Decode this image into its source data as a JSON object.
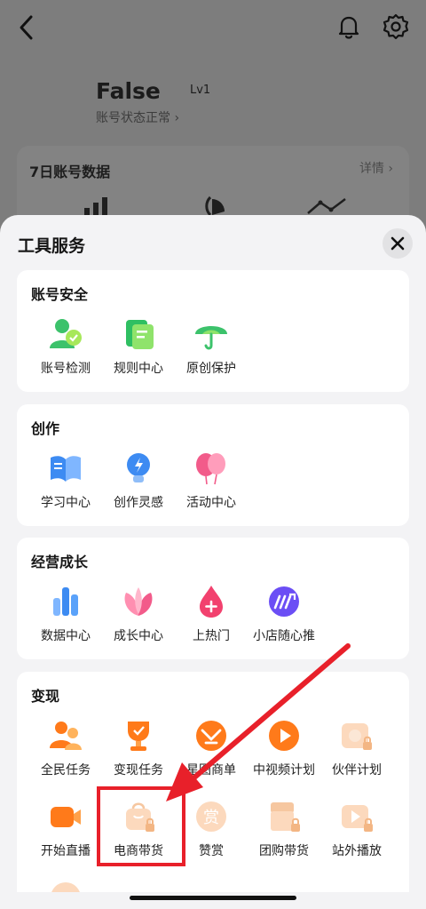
{
  "background": {
    "profile_name": "False",
    "level": "Lv1",
    "account_status": "账号状态正常 ›",
    "data_card": {
      "title": "7日账号数据",
      "more": "详情 ›"
    }
  },
  "sheet": {
    "title": "工具服务",
    "sections": [
      {
        "title": "账号安全",
        "items": [
          {
            "label": "账号检测",
            "icon": "account-check-icon"
          },
          {
            "label": "规则中心",
            "icon": "rules-icon"
          },
          {
            "label": "原创保护",
            "icon": "umbrella-icon"
          }
        ]
      },
      {
        "title": "创作",
        "items": [
          {
            "label": "学习中心",
            "icon": "book-icon"
          },
          {
            "label": "创作灵感",
            "icon": "lightbulb-icon"
          },
          {
            "label": "活动中心",
            "icon": "balloon-icon"
          }
        ]
      },
      {
        "title": "经营成长",
        "items": [
          {
            "label": "数据中心",
            "icon": "bar-chart-icon"
          },
          {
            "label": "成长中心",
            "icon": "lotus-icon"
          },
          {
            "label": "上热门",
            "icon": "fire-drop-icon"
          },
          {
            "label": "小店随心推",
            "icon": "promote-icon"
          }
        ]
      },
      {
        "title": "变现",
        "items": [
          {
            "label": "全民任务",
            "icon": "people-task-icon"
          },
          {
            "label": "变现任务",
            "icon": "trophy-icon"
          },
          {
            "label": "星图商单",
            "icon": "star-map-icon"
          },
          {
            "label": "中视频计划",
            "icon": "video-play-icon"
          },
          {
            "label": "伙伴计划",
            "icon": "partner-locked-icon"
          },
          {
            "label": "开始直播",
            "icon": "camera-icon"
          },
          {
            "label": "电商带货",
            "icon": "shopping-bag-locked-icon"
          },
          {
            "label": "赞赏",
            "icon": "reward-icon"
          },
          {
            "label": "团购带货",
            "icon": "group-buy-locked-icon"
          },
          {
            "label": "站外播放",
            "icon": "external-play-locked-icon"
          }
        ]
      }
    ]
  },
  "reward_glyph": "赏",
  "colors": {
    "highlight": "#e8202a",
    "sheet_bg": "#f3f3f5"
  }
}
